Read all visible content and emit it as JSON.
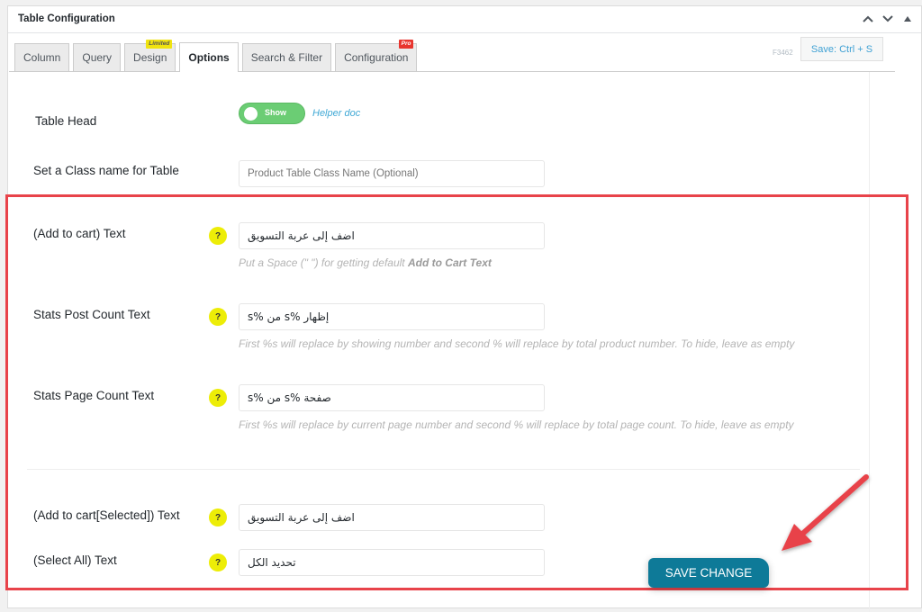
{
  "header": {
    "title": "Table Configuration",
    "controls": [
      "chevron-up",
      "chevron-down",
      "collapse-triangle"
    ]
  },
  "tabs": [
    {
      "label": "Column",
      "active": false
    },
    {
      "label": "Query",
      "active": false
    },
    {
      "label": "Design",
      "active": false,
      "badge": "Limited"
    },
    {
      "label": "Options",
      "active": true
    },
    {
      "label": "Search & Filter",
      "active": false
    },
    {
      "label": "Configuration",
      "active": false,
      "badge": "Pro"
    }
  ],
  "toolbar": {
    "form_id": "F3462",
    "save_shortcut_label": "Save: Ctrl + S"
  },
  "options": {
    "table_head": {
      "label": "Table Head",
      "toggle_label": "Show",
      "toggle_on": true,
      "helper_link": "Helper doc"
    },
    "class_name": {
      "label": "Set a Class name for Table",
      "value": "",
      "placeholder": "Product Table Class Name (Optional)"
    },
    "add_to_cart": {
      "label": "(Add to cart) Text",
      "value": "اضف إلى عربة التسويق",
      "desc_prefix": "Put a Space (\" \") for getting default ",
      "desc_bold": "Add to Cart Text"
    },
    "stats_post_count": {
      "label": "Stats Post Count Text",
      "value": "إظهار %s من %s",
      "desc": "First %s will replace by showing number and second % will replace by total product number. To hide, leave as empty"
    },
    "stats_page_count": {
      "label": "Stats Page Count Text",
      "value": "صفحة %s من %s",
      "desc": "First %s will replace by current page number and second % will replace by total page count. To hide, leave as empty"
    },
    "add_to_cart_selected": {
      "label": "(Add to cart[Selected]) Text",
      "value": "اضف إلى عربة التسويق"
    },
    "select_all": {
      "label": "(Select All) Text",
      "value": "تحديد الكل"
    },
    "help_icon_glyph": "?"
  },
  "footer": {
    "save_button_label": "SAVE CHANGE"
  },
  "colors": {
    "highlight_border": "#e8434a",
    "toggle_on": "#6bcd74",
    "save_button": "#0e7a98",
    "help_badge": "#eded07",
    "link": "#3fa8d5"
  }
}
